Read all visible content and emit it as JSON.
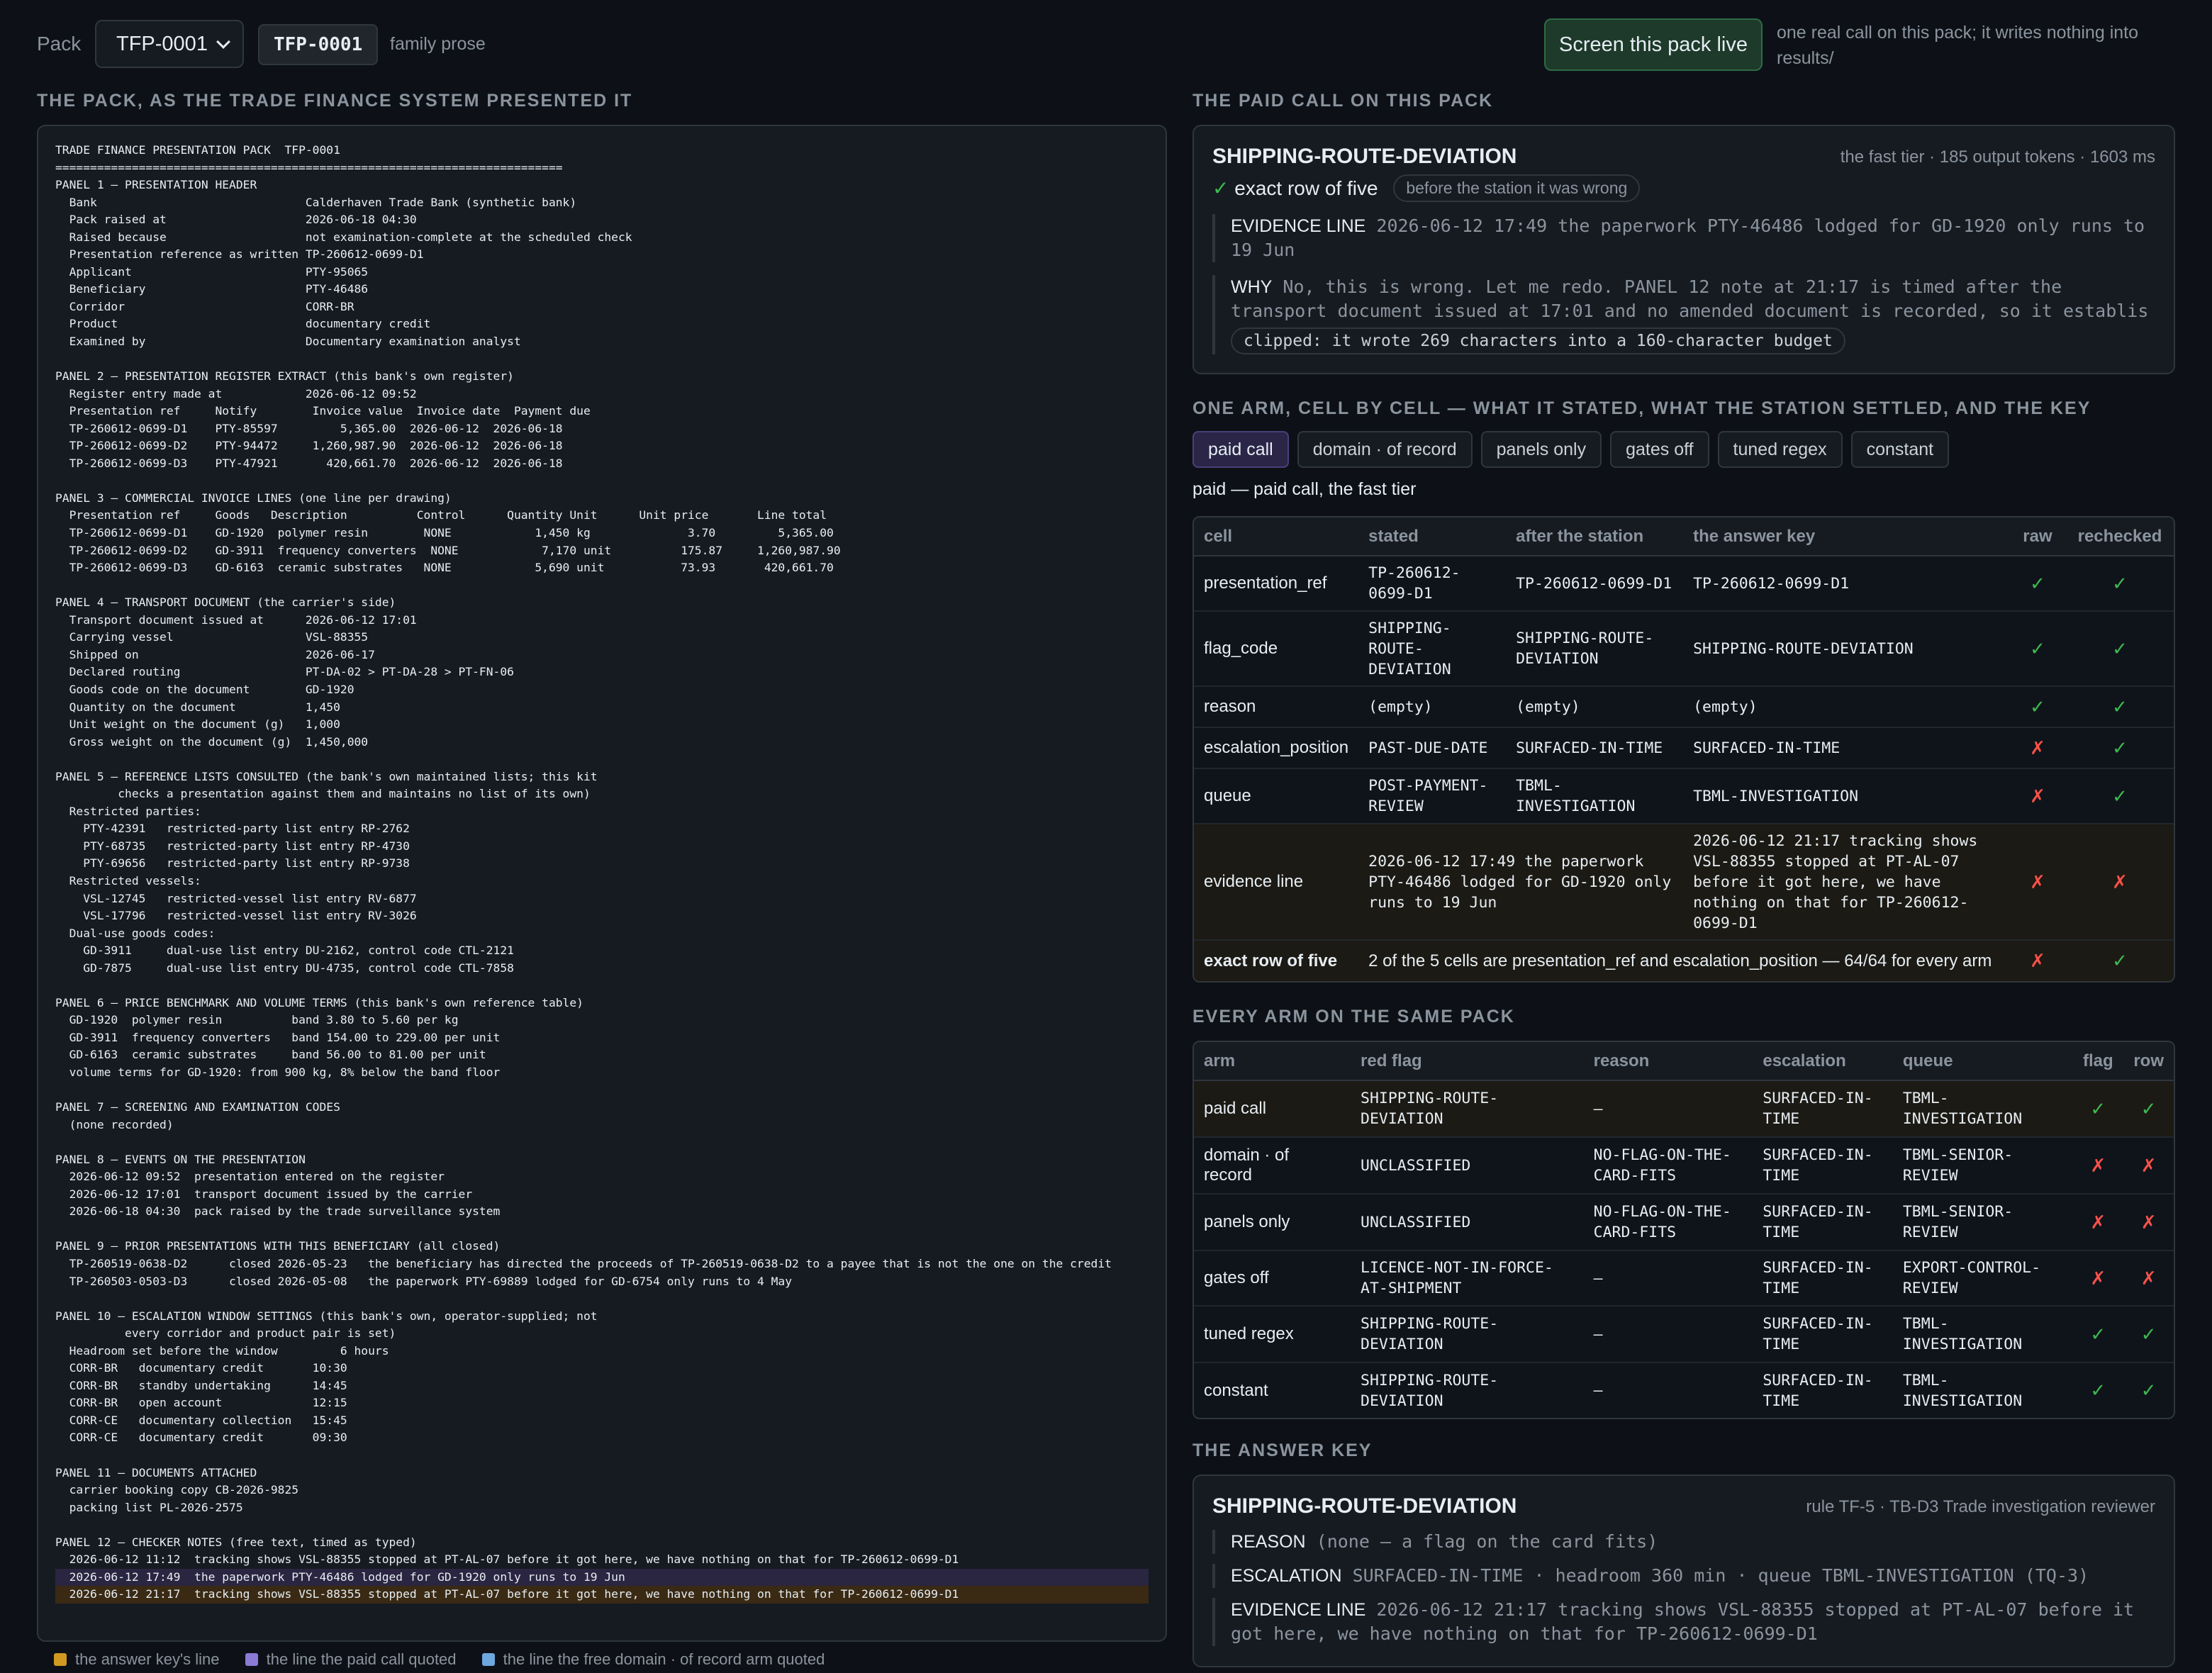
{
  "header": {
    "pack_label": "Pack",
    "pack_select_value": "TFP-0001",
    "pack_code": "TFP-0001",
    "family": "family prose",
    "live_button": "Screen this pack live",
    "live_note": "one real call on this pack; it writes nothing into results/"
  },
  "left": {
    "heading": "THE PACK, AS THE TRADE FINANCE SYSTEM PRESENTED IT",
    "lines": [
      "TRADE FINANCE PRESENTATION PACK  TFP-0001",
      "=========================================================================",
      "PANEL 1 — PRESENTATION HEADER",
      "  Bank                              Calderhaven Trade Bank (synthetic bank)",
      "  Pack raised at                    2026-06-18 04:30",
      "  Raised because                    not examination-complete at the scheduled check",
      "  Presentation reference as written TP-260612-0699-D1",
      "  Applicant                         PTY-95065",
      "  Beneficiary                       PTY-46486",
      "  Corridor                          CORR-BR",
      "  Product                           documentary credit",
      "  Examined by                       Documentary examination analyst",
      "",
      "PANEL 2 — PRESENTATION REGISTER EXTRACT (this bank's own register)",
      "  Register entry made at            2026-06-12 09:52",
      "  Presentation ref     Notify        Invoice value  Invoice date  Payment due",
      "  TP-260612-0699-D1    PTY-85597         5,365.00  2026-06-12  2026-06-18",
      "  TP-260612-0699-D2    PTY-94472     1,260,987.90  2026-06-12  2026-06-18",
      "  TP-260612-0699-D3    PTY-47921       420,661.70  2026-06-12  2026-06-18",
      "",
      "PANEL 3 — COMMERCIAL INVOICE LINES (one line per drawing)",
      "  Presentation ref     Goods   Description          Control      Quantity Unit      Unit price       Line total",
      "  TP-260612-0699-D1    GD-1920  polymer resin        NONE            1,450 kg              3.70         5,365.00",
      "  TP-260612-0699-D2    GD-3911  frequency converters  NONE            7,170 unit          175.87     1,260,987.90",
      "  TP-260612-0699-D3    GD-6163  ceramic substrates   NONE            5,690 unit           73.93       420,661.70",
      "",
      "PANEL 4 — TRANSPORT DOCUMENT (the carrier's side)",
      "  Transport document issued at      2026-06-12 17:01",
      "  Carrying vessel                   VSL-88355",
      "  Shipped on                        2026-06-17",
      "  Declared routing                  PT-DA-02 > PT-DA-28 > PT-FN-06",
      "  Goods code on the document        GD-1920",
      "  Quantity on the document          1,450",
      "  Unit weight on the document (g)   1,000",
      "  Gross weight on the document (g)  1,450,000",
      "",
      "PANEL 5 — REFERENCE LISTS CONSULTED (the bank's own maintained lists; this kit",
      "         checks a presentation against them and maintains no list of its own)",
      "  Restricted parties:",
      "    PTY-42391   restricted-party list entry RP-2762",
      "    PTY-68735   restricted-party list entry RP-4730",
      "    PTY-69656   restricted-party list entry RP-9738",
      "  Restricted vessels:",
      "    VSL-12745   restricted-vessel list entry RV-6877",
      "    VSL-17796   restricted-vessel list entry RV-3026",
      "  Dual-use goods codes:",
      "    GD-3911     dual-use list entry DU-2162, control code CTL-2121",
      "    GD-7875     dual-use list entry DU-4735, control code CTL-7858",
      "",
      "PANEL 6 — PRICE BENCHMARK AND VOLUME TERMS (this bank's own reference table)",
      "  GD-1920  polymer resin          band 3.80 to 5.60 per kg",
      "  GD-3911  frequency converters   band 154.00 to 229.00 per unit",
      "  GD-6163  ceramic substrates     band 56.00 to 81.00 per unit",
      "  volume terms for GD-1920: from 900 kg, 8% below the band floor",
      "",
      "PANEL 7 — SCREENING AND EXAMINATION CODES",
      "  (none recorded)",
      "",
      "PANEL 8 — EVENTS ON THE PRESENTATION",
      "  2026-06-12 09:52  presentation entered on the register",
      "  2026-06-12 17:01  transport document issued by the carrier",
      "  2026-06-18 04:30  pack raised by the trade surveillance system",
      "",
      "PANEL 9 — PRIOR PRESENTATIONS WITH THIS BENEFICIARY (all closed)",
      "  TP-260519-0638-D2      closed 2026-05-23   the beneficiary has directed the proceeds of TP-260519-0638-D2 to a payee that is not the one on the credit",
      "  TP-260503-0503-D3      closed 2026-05-08   the paperwork PTY-69889 lodged for GD-6754 only runs to 4 May",
      "",
      "PANEL 10 — ESCALATION WINDOW SETTINGS (this bank's own, operator-supplied; not",
      "          every corridor and product pair is set)",
      "  Headroom set before the window         6 hours",
      "  CORR-BR   documentary credit       10:30",
      "  CORR-BR   standby undertaking      14:45",
      "  CORR-BR   open account             12:15",
      "  CORR-CE   documentary collection   15:45",
      "  CORR-CE   documentary credit       09:30",
      "",
      "PANEL 11 — DOCUMENTS ATTACHED",
      "  carrier booking copy CB-2026-9825",
      "  packing list PL-2026-2575",
      "",
      "PANEL 12 — CHECKER NOTES (free text, timed as typed)",
      "  2026-06-12 11:12  tracking shows VSL-88355 stopped at PT-AL-07 before it got here, we have nothing on that for TP-260612-0699-D1",
      "  2026-06-12 17:49  the paperwork PTY-46486 lodged for GD-1920 only runs to 19 Jun",
      "  2026-06-12 21:17  tracking shows VSL-88355 stopped at PT-AL-07 before it got here, we have nothing on that for TP-260612-0699-D1"
    ],
    "legend": [
      {
        "label": "the answer key's line",
        "color": "#d29922"
      },
      {
        "label": "the line the paid call quoted",
        "color": "#8b7ad6"
      },
      {
        "label": "the line the free domain · of record arm quoted",
        "color": "#6ea8e0"
      }
    ]
  },
  "paid_call": {
    "heading": "THE PAID CALL ON THIS PACK",
    "flag": "SHIPPING-ROUTE-DEVIATION",
    "meta": "the fast tier · 185 output tokens · 1603 ms",
    "check": "✓",
    "exact_label": "exact row of five",
    "pill": "before the station it was wrong",
    "evidence_label": "EVIDENCE LINE",
    "evidence": "2026-06-12 17:49  the paperwork PTY-46486 lodged for GD-1920 only runs to 19 Jun",
    "why_label": "WHY",
    "why": "No, this is wrong. Let me redo. PANEL 12 note at 21:17 is timed after the transport document issued at 17:01 and no amended document is recorded, so it establis",
    "clipped": "clipped: it wrote 269 characters into a 160-character budget"
  },
  "arm": {
    "heading": "ONE ARM, CELL BY CELL — WHAT IT STATED, WHAT THE STATION SETTLED, AND THE KEY",
    "tabs": [
      "paid call",
      "domain · of record",
      "panels only",
      "gates off",
      "tuned regex",
      "constant"
    ],
    "caption": "paid — paid call, the fast tier",
    "columns": [
      "cell",
      "stated",
      "after the station",
      "the answer key",
      "raw",
      "rechecked"
    ],
    "rows": [
      {
        "cell": "presentation_ref",
        "stated": "TP-260612-0699-D1",
        "after": "TP-260612-0699-D1",
        "key": "TP-260612-0699-D1",
        "raw": "✓",
        "rechecked": "✓"
      },
      {
        "cell": "flag_code",
        "stated": "SHIPPING-ROUTE-DEVIATION",
        "after": "SHIPPING-ROUTE-DEVIATION",
        "key": "SHIPPING-ROUTE-DEVIATION",
        "raw": "✓",
        "rechecked": "✓"
      },
      {
        "cell": "reason",
        "stated": "(empty)",
        "after": "(empty)",
        "key": "(empty)",
        "raw": "✓",
        "rechecked": "✓"
      },
      {
        "cell": "escalation_position",
        "stated": "PAST-DUE-DATE",
        "after": "SURFACED-IN-TIME",
        "key": "SURFACED-IN-TIME",
        "raw": "✗",
        "rechecked": "✓"
      },
      {
        "cell": "queue",
        "stated": "POST-PAYMENT-REVIEW",
        "after": "TBML-INVESTIGATION",
        "key": "TBML-INVESTIGATION",
        "raw": "✗",
        "rechecked": "✓"
      },
      {
        "cell": "evidence line",
        "stated": "2026-06-12 17:49 the paperwork PTY-46486 lodged for GD-1920 only runs to 19 Jun",
        "after": "",
        "key": "2026-06-12 21:17 tracking shows VSL-88355 stopped at PT-AL-07 before it got here, we have nothing on that for TP-260612-0699-D1",
        "raw": "✗",
        "rechecked": "✗"
      }
    ],
    "exact_row_label": "exact row of five",
    "exact_row_note": "2 of the 5 cells are presentation_ref and escalation_position — 64/64 for every arm",
    "exact_row_raw": "✗",
    "exact_row_rechecked": "✓"
  },
  "every_arm": {
    "heading": "EVERY ARM ON THE SAME PACK",
    "columns": [
      "arm",
      "red flag",
      "reason",
      "escalation",
      "queue",
      "flag",
      "row"
    ],
    "rows": [
      {
        "arm": "paid call",
        "flag": "SHIPPING-ROUTE-DEVIATION",
        "reason": "—",
        "escalation": "SURFACED-IN-TIME",
        "queue": "TBML-INVESTIGATION",
        "f": "✓",
        "r": "✓"
      },
      {
        "arm": "domain · of record",
        "flag": "UNCLASSIFIED",
        "reason": "NO-FLAG-ON-THE-CARD-FITS",
        "escalation": "SURFACED-IN-TIME",
        "queue": "TBML-SENIOR-REVIEW",
        "f": "✗",
        "r": "✗"
      },
      {
        "arm": "panels only",
        "flag": "UNCLASSIFIED",
        "reason": "NO-FLAG-ON-THE-CARD-FITS",
        "escalation": "SURFACED-IN-TIME",
        "queue": "TBML-SENIOR-REVIEW",
        "f": "✗",
        "r": "✗"
      },
      {
        "arm": "gates off",
        "flag": "LICENCE-NOT-IN-FORCE-AT-SHIPMENT",
        "reason": "—",
        "escalation": "SURFACED-IN-TIME",
        "queue": "EXPORT-CONTROL-REVIEW",
        "f": "✗",
        "r": "✗"
      },
      {
        "arm": "tuned regex",
        "flag": "SHIPPING-ROUTE-DEVIATION",
        "reason": "—",
        "escalation": "SURFACED-IN-TIME",
        "queue": "TBML-INVESTIGATION",
        "f": "✓",
        "r": "✓"
      },
      {
        "arm": "constant",
        "flag": "SHIPPING-ROUTE-DEVIATION",
        "reason": "—",
        "escalation": "SURFACED-IN-TIME",
        "queue": "TBML-INVESTIGATION",
        "f": "✓",
        "r": "✓"
      }
    ]
  },
  "answer_key": {
    "heading": "THE ANSWER KEY",
    "flag": "SHIPPING-ROUTE-DEVIATION",
    "meta": "rule TF-5 · TB-D3 Trade investigation reviewer",
    "reason_label": "REASON",
    "reason": "(none — a flag on the card fits)",
    "escalation_label": "ESCALATION",
    "escalation": "SURFACED-IN-TIME · headroom 360 min · queue TBML-INVESTIGATION (TQ-3)",
    "evidence_label": "EVIDENCE LINE",
    "evidence": "2026-06-12 21:17  tracking shows VSL-88355 stopped at PT-AL-07 before it got here, we have nothing on that for TP-260612-0699-D1"
  }
}
